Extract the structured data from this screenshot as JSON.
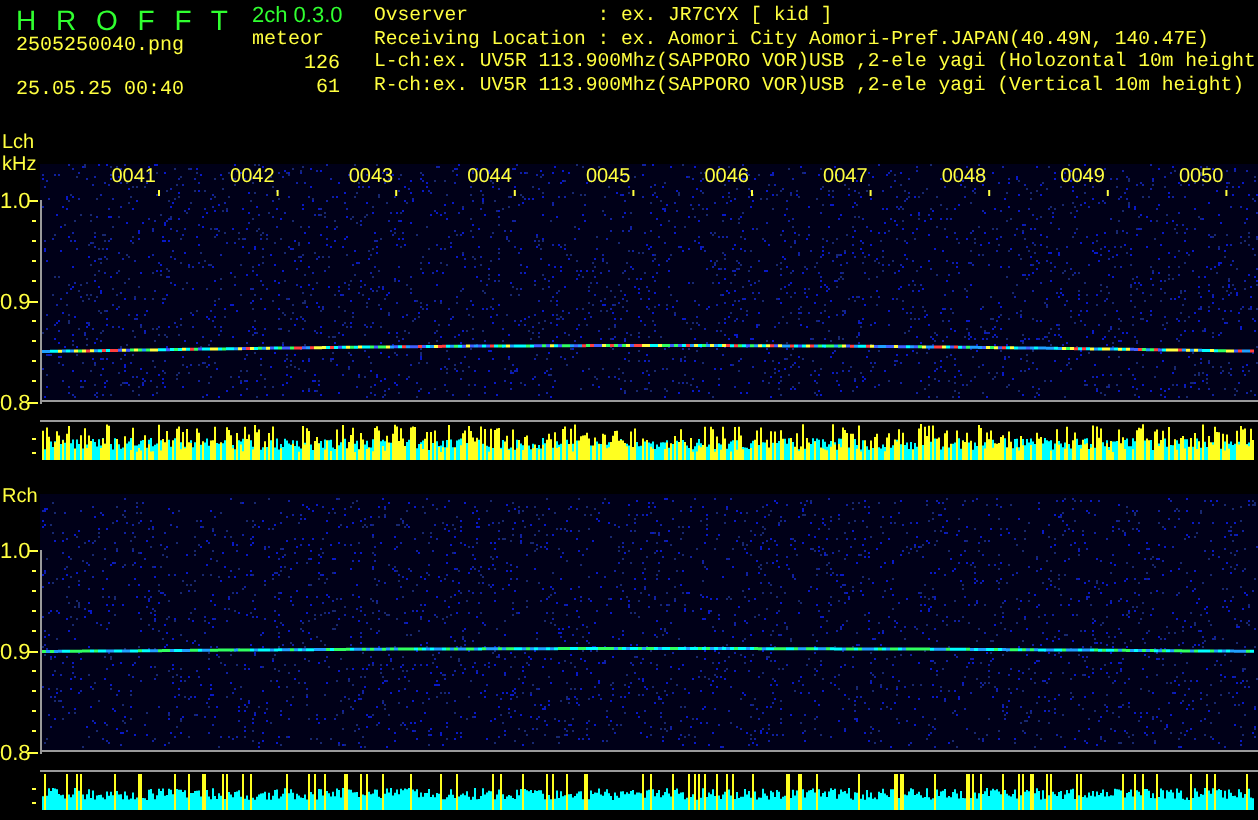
{
  "header": {
    "app_name": "H R O F F T",
    "file": "2505250040.png",
    "datetime": "25.05.25 00:40",
    "version": "2ch 0.3.0",
    "meteor_label": "meteor",
    "counts": [
      "126",
      "61"
    ],
    "info": [
      "Ovserver           : ex. JR7CYX [ kid ]",
      "Receiving Location : ex. Aomori City Aomori-Pref.JAPAN(40.49N, 140.47E)",
      "L-ch:ex. UV5R 113.900Mhz(SAPPORO VOR)USB ,2-ele yagi (Holozontal 10m height",
      "R-ch:ex. UV5R 113.900Mhz(SAPPORO VOR)USB ,2-ele yagi (Vertical 10m height)"
    ]
  },
  "channels": [
    {
      "name": "Lch",
      "unit": "kHz",
      "time_labels": [
        "0041",
        "0042",
        "0043",
        "0044",
        "0045",
        "0046",
        "0047",
        "0048",
        "0049",
        "0050"
      ],
      "freq_labels": [
        "1.0",
        "0.9",
        "0.8"
      ]
    },
    {
      "name": "Rch",
      "freq_labels": [
        "1.0",
        "0.9",
        "0.8"
      ]
    }
  ]
}
